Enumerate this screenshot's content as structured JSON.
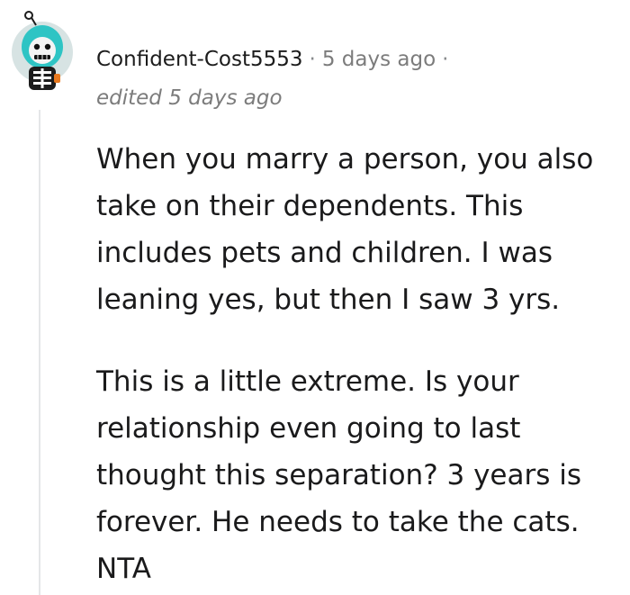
{
  "comment": {
    "author": "Confident-Cost5553",
    "timestamp": "5 days ago",
    "edited": "edited 5 days ago",
    "avatar_icon": "skeleton-snoo-avatar-icon",
    "paragraphs": [
      {
        "lines": [
          "When you marry a person, you also",
          "take on their dependents. This",
          "includes pets and children. I was",
          "leaning yes, but then I saw 3 yrs."
        ]
      },
      {
        "lines": [
          "This is a little extreme. Is your",
          "relationship even going to last",
          "thought this separation? 3 years is",
          "forever. He needs to take the cats.",
          "NTA"
        ]
      }
    ]
  },
  "colors": {
    "author": "#1c1c1c",
    "meta": "#7c7c7c",
    "body": "#1a1a1b",
    "thread_line": "#e4e6e8",
    "avatar_bg": "#d7e3e3",
    "avatar_hood": "#2ec4c4"
  }
}
